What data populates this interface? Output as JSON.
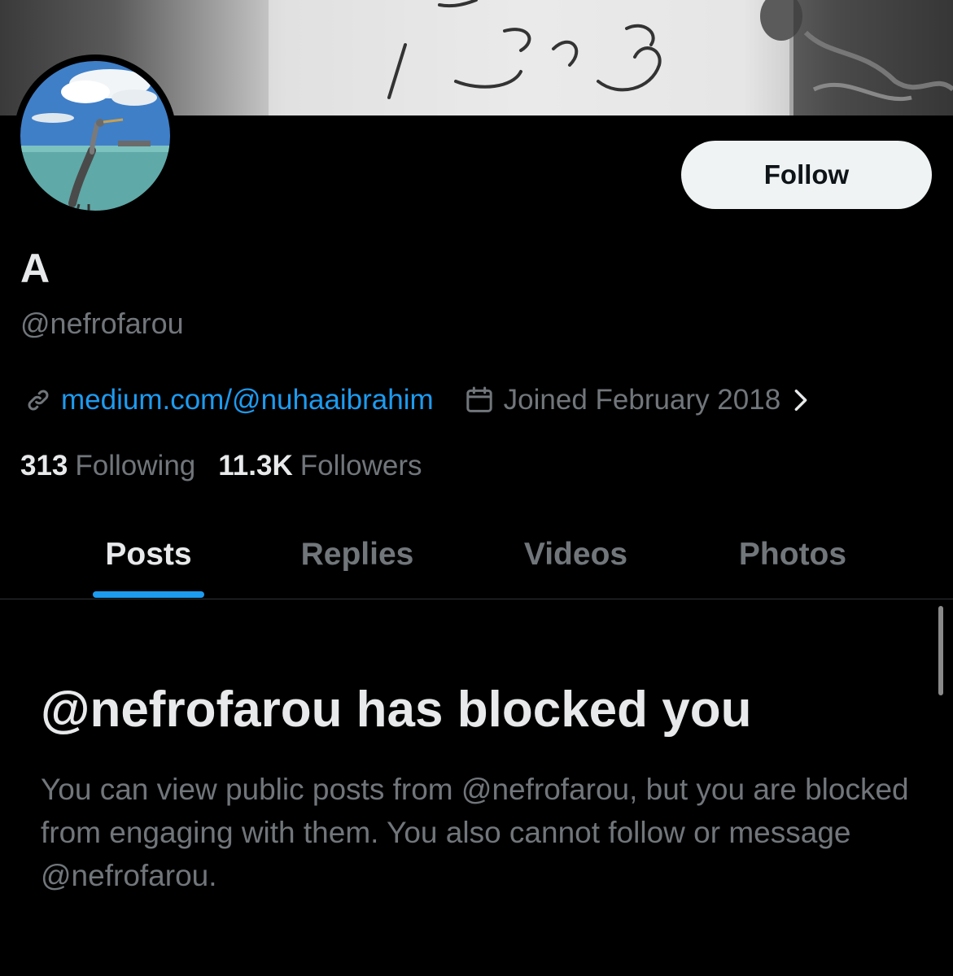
{
  "profile": {
    "display_name": "A",
    "handle": "@nefrofarou",
    "website": "medium.com/@nuhaaibrahim",
    "joined": "Joined February 2018",
    "follow_label": "Follow",
    "banner_icon": "banner-photo",
    "avatar_icon": "heron-photo-avatar"
  },
  "stats": {
    "following_count": "313",
    "following_label": "Following",
    "followers_count": "11.3K",
    "followers_label": "Followers"
  },
  "tabs": [
    {
      "label": "Posts",
      "active": true
    },
    {
      "label": "Replies",
      "active": false
    },
    {
      "label": "Videos",
      "active": false
    },
    {
      "label": "Photos",
      "active": false
    }
  ],
  "blocked": {
    "title": "@nefrofarou has blocked you",
    "description": "You can view public posts from @nefrofarou, but you are blocked from engaging with them. You also cannot follow or message @nefrofarou."
  },
  "icons": {
    "link": "link-icon",
    "calendar": "calendar-icon",
    "chevron": "chevron-right-icon"
  },
  "colors": {
    "background": "#000000",
    "accent": "#1d9bf0",
    "primary_text": "#e7e9ea",
    "secondary_text": "#71767b",
    "follow_button_bg": "#eff3f4"
  }
}
